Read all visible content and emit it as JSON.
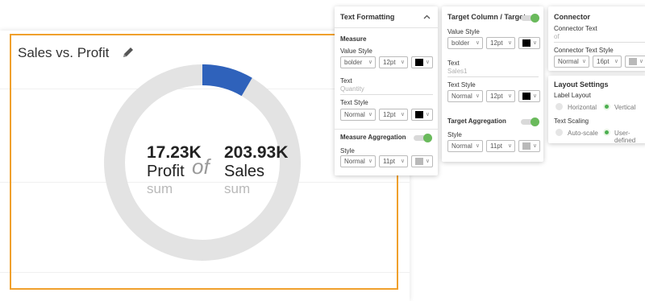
{
  "chart": {
    "title": "Sales vs. Profit",
    "measure_value": "17.23K",
    "measure_name": "Profit",
    "measure_agg": "sum",
    "connector": "of",
    "target_value": "203.93K",
    "target_name": "Sales",
    "target_agg": "sum"
  },
  "chart_data": {
    "type": "pie",
    "variant": "donut",
    "series": [
      {
        "name": "Profit",
        "values": [
          17.23
        ]
      },
      {
        "name": "Sales",
        "values": [
          203.93
        ]
      }
    ],
    "colors": {
      "filled": "#2f62bb",
      "track": "#e3e3e3"
    }
  },
  "text_formatting": {
    "header": "Text Formatting",
    "measure_section": "Measure",
    "value_style_label": "Value Style",
    "value_weight": "bolder",
    "value_size": "12pt",
    "value_color": "#000000",
    "text_label": "Text",
    "text_placeholder": "Quantity",
    "text_style_label": "Text Style",
    "text_weight": "Normal",
    "text_size": "12pt",
    "text_color": "#000000",
    "aggregation_section": "Measure Aggregation",
    "agg_style_label": "Style",
    "agg_weight": "Normal",
    "agg_size": "11pt",
    "agg_color": "#b9b9b9"
  },
  "target_panel": {
    "header": "Target Column / Target",
    "value_style_label": "Value Style",
    "value_weight": "bolder",
    "value_size": "12pt",
    "value_color": "#000000",
    "text_label": "Text",
    "text_placeholder": "Sales1",
    "text_style_label": "Text Style",
    "text_weight": "Normal",
    "text_size": "12pt",
    "text_color": "#000000",
    "aggregation_section": "Target Aggregation",
    "agg_style_label": "Style",
    "agg_weight": "Normal",
    "agg_size": "11pt",
    "agg_color": "#b9b9b9"
  },
  "connector_panel": {
    "header": "Connector",
    "text_label": "Connector Text",
    "text_placeholder": "of",
    "style_label": "Connector Text Style",
    "weight": "Normal",
    "size": "16pt",
    "color": "#b9b9b9"
  },
  "layout_panel": {
    "header": "Layout Settings",
    "label_layout": "Label Layout",
    "horizontal": "Horizontal",
    "vertical": "Vertical",
    "text_scaling": "Text Scaling",
    "auto_scale": "Auto-scale",
    "user_defined": "User-defined"
  }
}
